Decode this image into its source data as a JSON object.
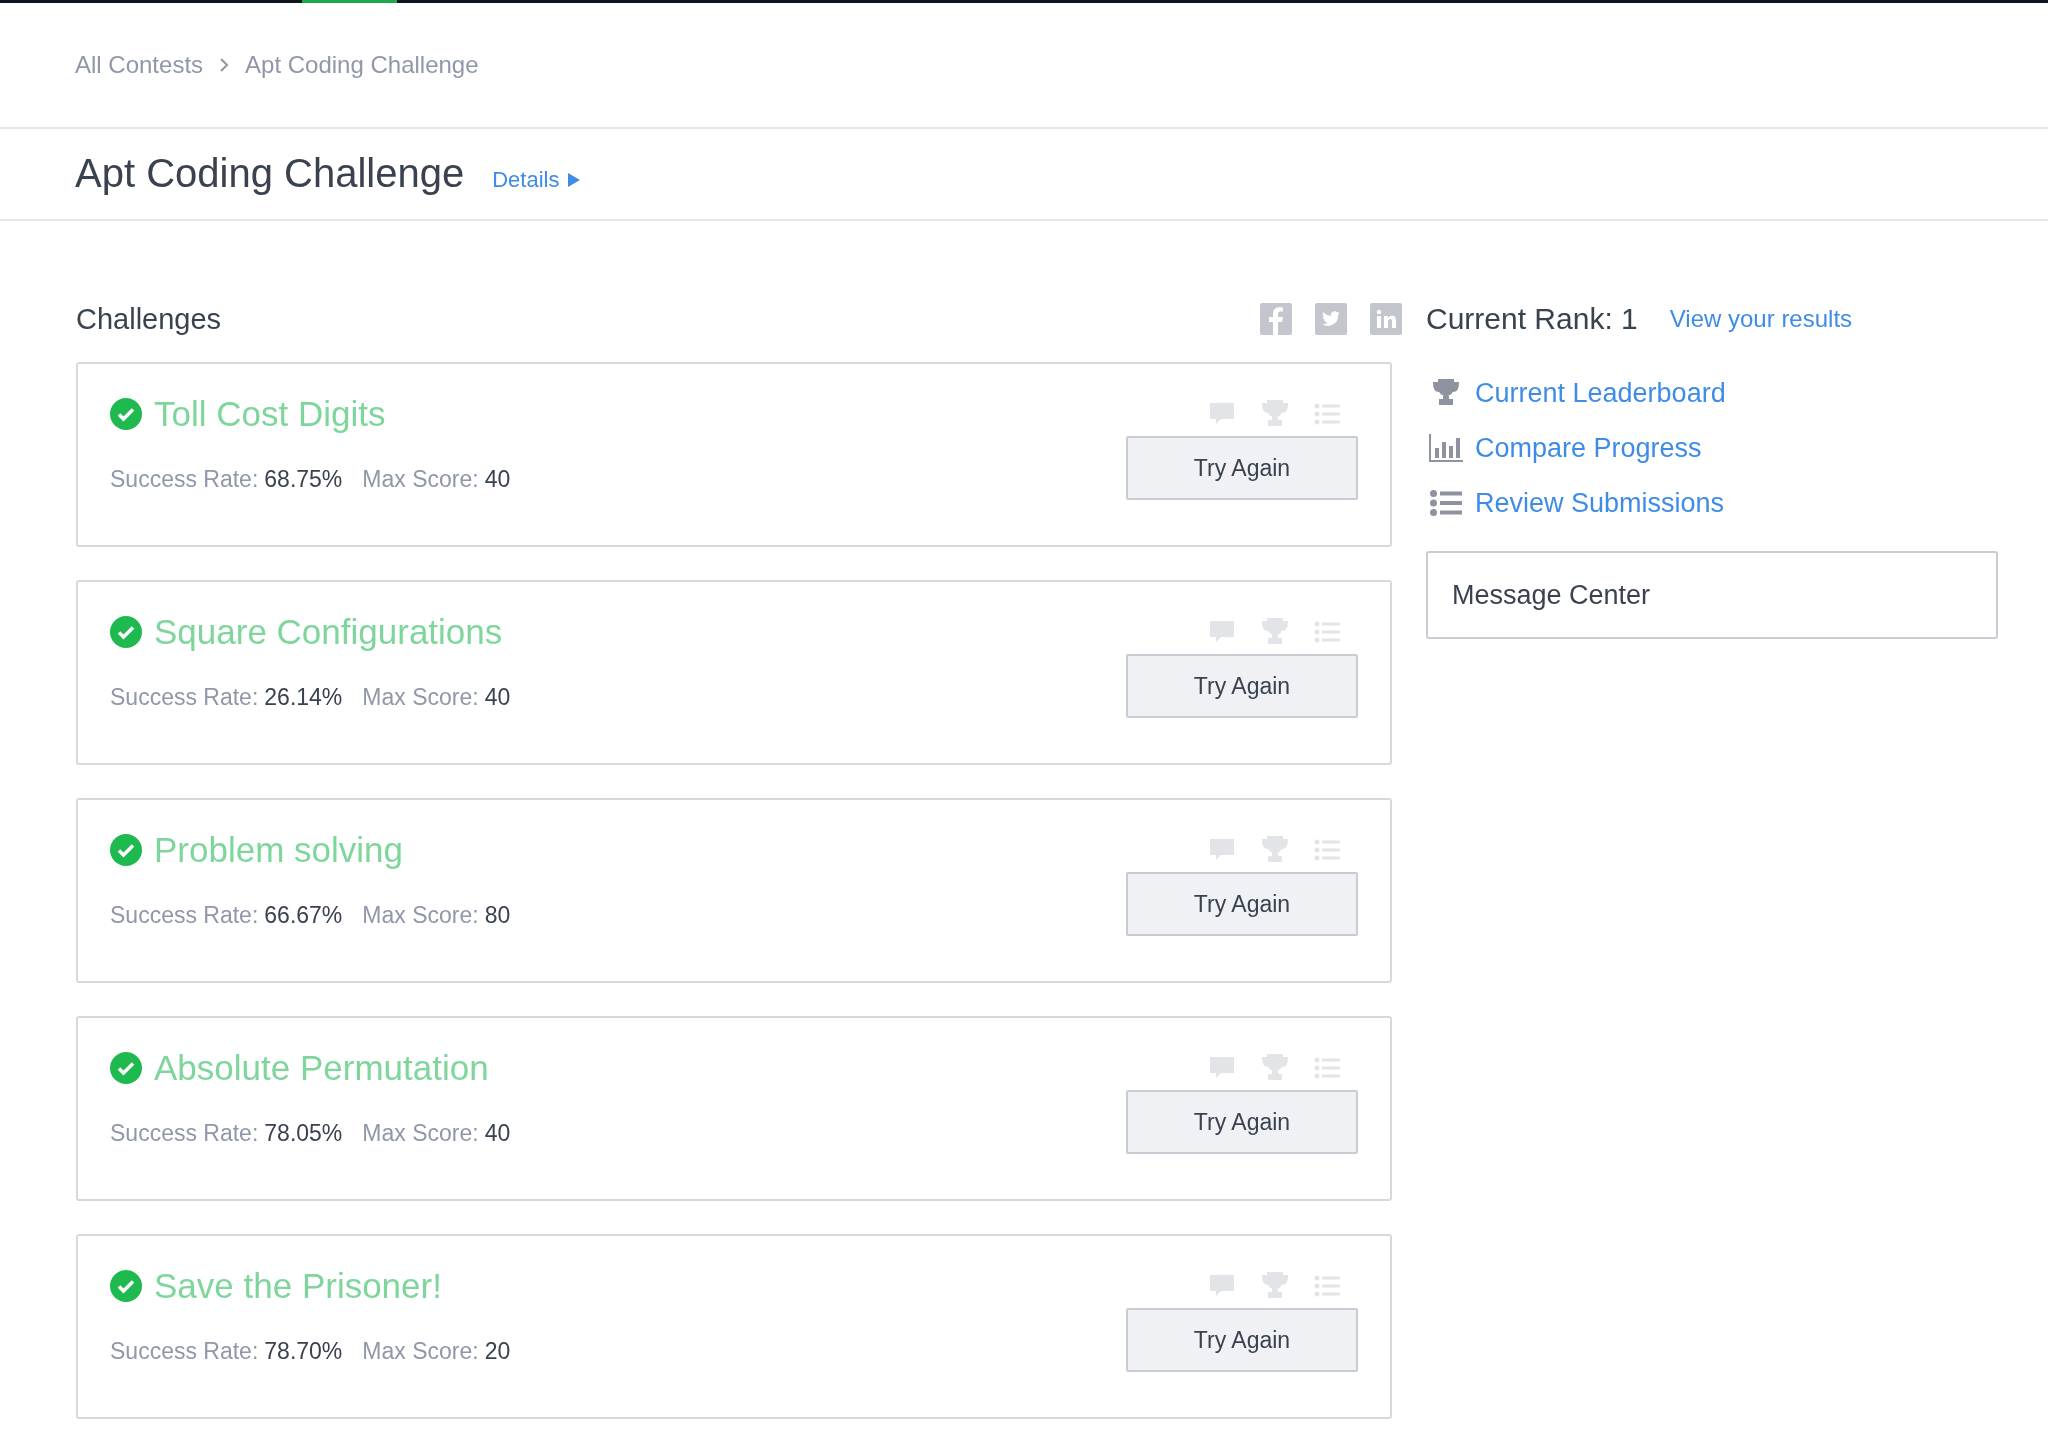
{
  "breadcrumb": [
    "All Contests",
    "Apt Coding Challenge"
  ],
  "header": {
    "title": "Apt Coding Challenge",
    "details_link": "Details"
  },
  "challenges_heading": "Challenges",
  "challenges": [
    {
      "title": "Toll Cost Digits",
      "solved": true,
      "success_label": "Success Rate:",
      "success_rate": "68.75%",
      "score_label": "Max Score:",
      "max_score": "40",
      "button": "Try Again"
    },
    {
      "title": "Square Configurations",
      "solved": true,
      "success_label": "Success Rate:",
      "success_rate": "26.14%",
      "score_label": "Max Score:",
      "max_score": "40",
      "button": "Try Again"
    },
    {
      "title": "Problem solving",
      "solved": true,
      "success_label": "Success Rate:",
      "success_rate": "66.67%",
      "score_label": "Max Score:",
      "max_score": "80",
      "button": "Try Again"
    },
    {
      "title": "Absolute Permutation",
      "solved": true,
      "success_label": "Success Rate:",
      "success_rate": "78.05%",
      "score_label": "Max Score:",
      "max_score": "40",
      "button": "Try Again"
    },
    {
      "title": "Save the Prisoner!",
      "solved": true,
      "success_label": "Success Rate:",
      "success_rate": "78.70%",
      "score_label": "Max Score:",
      "max_score": "20",
      "button": "Try Again"
    }
  ],
  "sidebar": {
    "rank": "Current Rank: 1",
    "results_link": "View your results",
    "links": [
      {
        "kind": "trophy",
        "label": "Current Leaderboard"
      },
      {
        "kind": "chart",
        "label": "Compare Progress"
      },
      {
        "kind": "list",
        "label": "Review Submissions"
      }
    ],
    "message_center": "Message Center"
  }
}
